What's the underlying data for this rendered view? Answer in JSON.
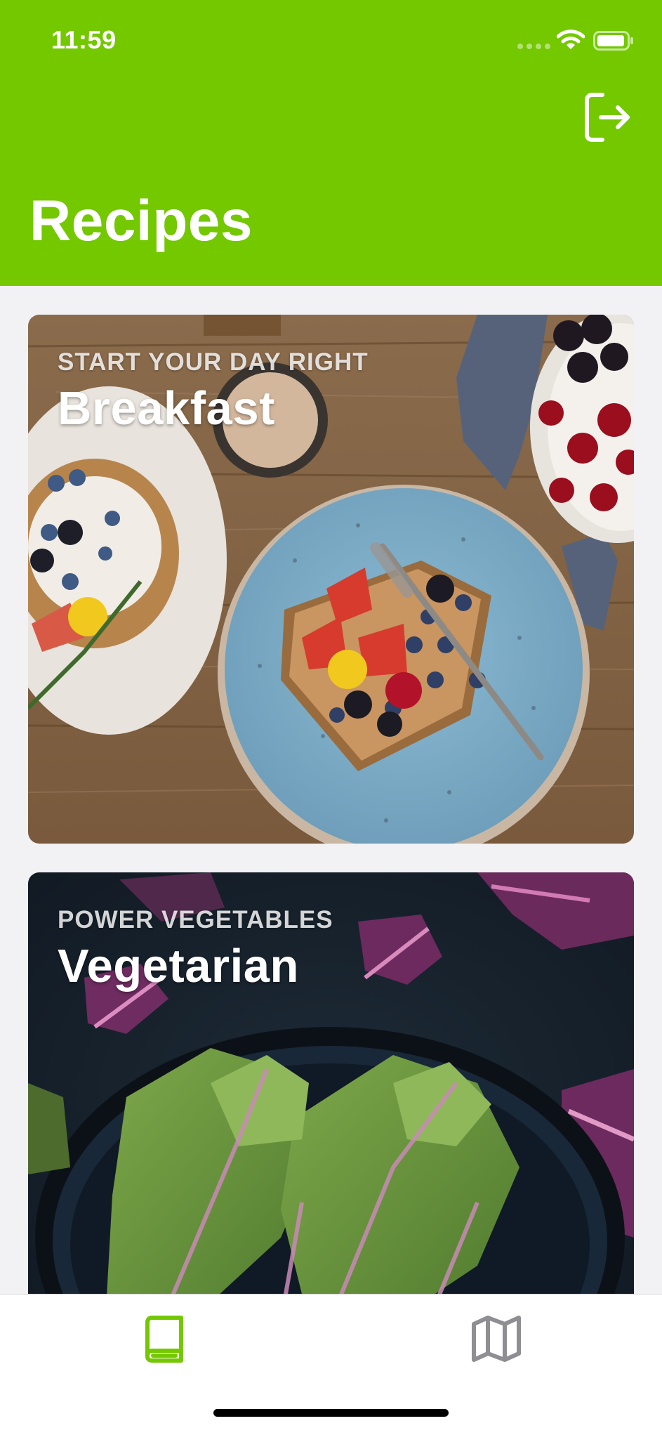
{
  "status_bar": {
    "time": "11:59",
    "icons": [
      "cellular-signal-icon",
      "wifi-icon",
      "battery-icon"
    ]
  },
  "header": {
    "title": "Recipes",
    "action_icon": "logout-icon",
    "background_color": "#73c800"
  },
  "cards": [
    {
      "eyebrow": "START YOUR DAY RIGHT",
      "title": "Breakfast",
      "image_subject": "french toast with strawberries and blueberries on a blue plate"
    },
    {
      "eyebrow": "POWER VEGETABLES",
      "title": "Vegetarian",
      "image_subject": "purple-veined cabbage leaves in a dark bowl"
    }
  ],
  "tab_bar": {
    "tabs": [
      {
        "icon": "book-icon",
        "active": true,
        "color": "#73c800"
      },
      {
        "icon": "map-icon",
        "active": false,
        "color": "#8e8e93"
      }
    ]
  }
}
